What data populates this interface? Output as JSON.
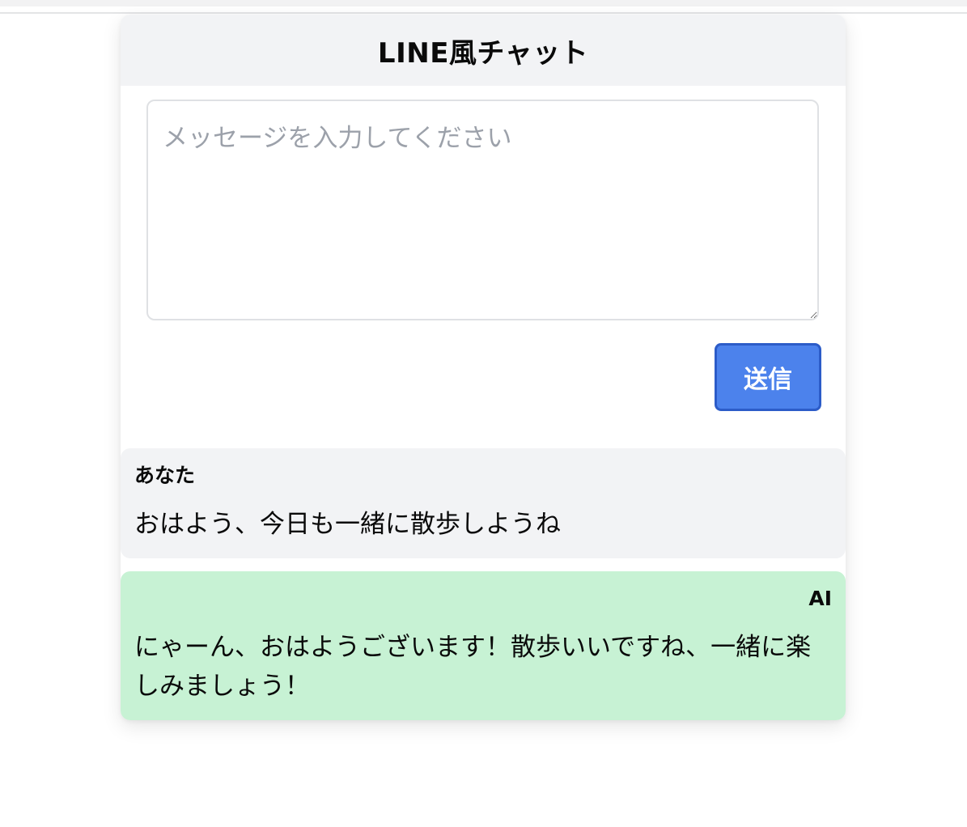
{
  "header": {
    "title": "LINE風チャット"
  },
  "composer": {
    "placeholder": "メッセージを入力してください",
    "value": "",
    "send_label": "送信",
    "send_color": "#4c82ec"
  },
  "messages": [
    {
      "sender": "あなた",
      "text": "おはよう、今日も一緒に散歩しようね",
      "bubble_color": "#f2f3f5"
    },
    {
      "sender": "AI",
      "text": "にゃーん、おはようございます！散歩いいですね、一緒に楽しみましょう！",
      "bubble_color": "#c7f2d4"
    }
  ]
}
